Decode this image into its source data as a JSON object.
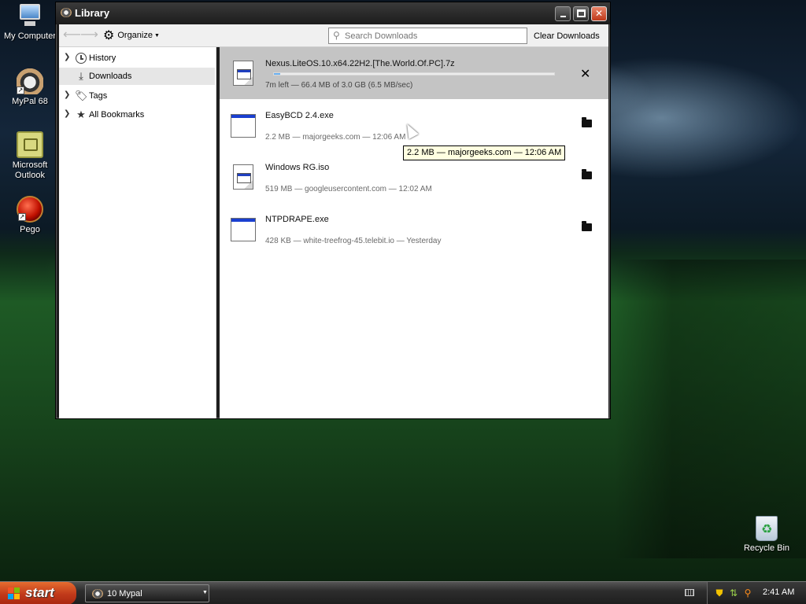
{
  "desktop": {
    "icons": [
      {
        "label": "My Computer",
        "icon": "my-computer-icon"
      },
      {
        "label": "MyPal 68",
        "icon": "mypal-icon"
      },
      {
        "label": "Microsoft Outlook",
        "icon": "outlook-icon"
      },
      {
        "label": "Pego",
        "icon": "pego-icon"
      },
      {
        "label": "Recycle Bin",
        "icon": "recycle-bin-icon"
      }
    ]
  },
  "window": {
    "title": "Library",
    "toolbar": {
      "organize_label": "Organize",
      "search_placeholder": "Search Downloads",
      "clear_label": "Clear Downloads"
    },
    "sidebar": {
      "items": [
        {
          "label": "History",
          "icon": "clock-icon",
          "expandable": true,
          "selected": false
        },
        {
          "label": "Downloads",
          "icon": "download-icon",
          "expandable": false,
          "selected": true
        },
        {
          "label": "Tags",
          "icon": "tag-icon",
          "expandable": true,
          "selected": false
        },
        {
          "label": "All Bookmarks",
          "icon": "star-icon",
          "expandable": true,
          "selected": false
        }
      ]
    },
    "downloads": [
      {
        "name": "Nexus.LiteOS.10.x64.22H2.[The.World.Of.PC].7z",
        "meta": "7m left — 66.4 MB of 3.0 GB (6.5 MB/sec)",
        "progress": 0.022,
        "action": "cancel-icon",
        "icon": "document-file-icon"
      },
      {
        "name": "EasyBCD 2.4.exe",
        "meta": "2.2 MB — majorgeeks.com — 12:06 AM",
        "action": "folder-icon",
        "icon": "exe-file-icon"
      },
      {
        "name": "Windows RG.iso",
        "meta": "519 MB — googleusercontent.com — 12:02 AM",
        "action": "folder-icon",
        "icon": "document-file-icon"
      },
      {
        "name": "NTPDRAPE.exe",
        "meta": "428 KB — white-treefrog-45.telebit.io — Yesterday",
        "action": "folder-icon",
        "icon": "exe-file-icon"
      }
    ],
    "tooltip": "2.2 MB — majorgeeks.com — 12:06 AM"
  },
  "taskbar": {
    "start_label": "start",
    "task_label": "10 Mypal",
    "clock": "2:41 AM"
  },
  "colors": {
    "selected_row": "#c4c4c4",
    "start_button": "#c0391a",
    "progress_fill": "#6ab0f0"
  }
}
